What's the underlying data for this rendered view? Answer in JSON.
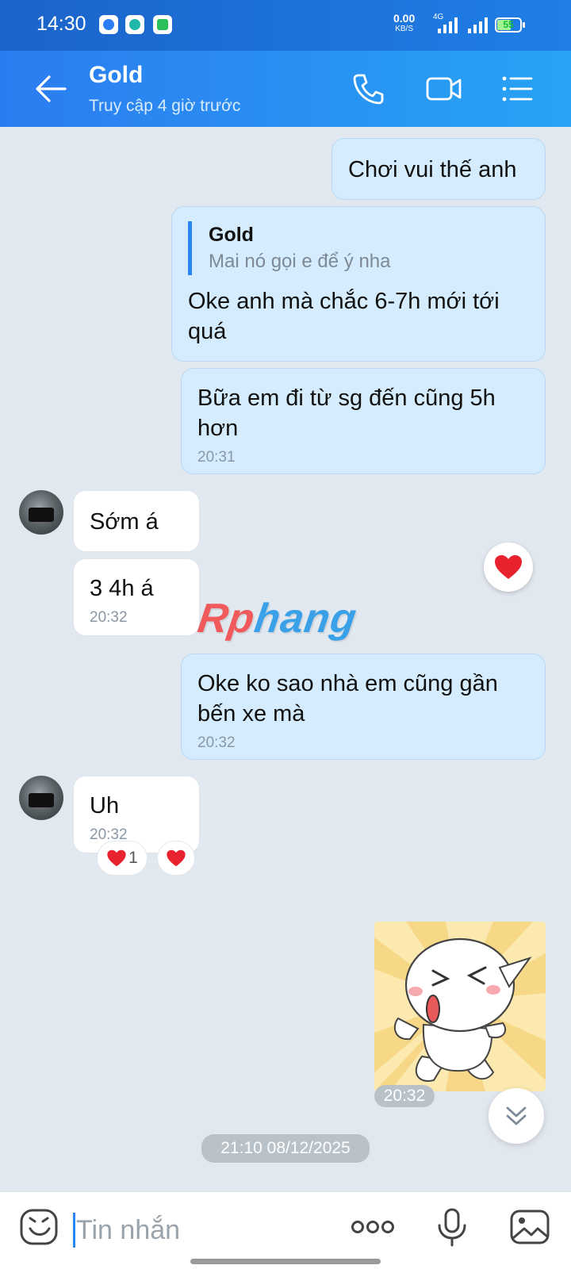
{
  "status_bar": {
    "time": "14:30",
    "net_speed": "0.00",
    "net_unit": "KB/S",
    "network": "4G",
    "battery": "55"
  },
  "header": {
    "name": "Gold",
    "status": "Truy cập 4 giờ trước",
    "icons": [
      "back-arrow-icon",
      "phone-icon",
      "video-call-icon",
      "menu-icon"
    ]
  },
  "messages": [
    {
      "side": "out",
      "text": "Chơi vui thế anh"
    },
    {
      "side": "out",
      "reply_to": {
        "name": "Gold",
        "text": "Mai nó gọi e để ý nha"
      },
      "text": "Oke anh mà chắc 6-7h mới tới quá"
    },
    {
      "side": "out",
      "text": "Bữa em đi từ sg đến cũng 5h hơn",
      "time": "20:31"
    },
    {
      "side": "in",
      "text": "Sớm á"
    },
    {
      "side": "in",
      "text": "3 4h á",
      "time": "20:32"
    },
    {
      "side": "out",
      "text": "Oke ko sao nhà em cũng gần bến xe mà",
      "time": "20:32"
    },
    {
      "side": "in",
      "text": "Uh",
      "time": "20:32",
      "reaction_count": "1"
    },
    {
      "side": "out",
      "type": "sticker",
      "time": "20:32"
    }
  ],
  "watermark": {
    "part1": "Rp",
    "part2": "hang"
  },
  "date_separator": "21:10 08/12/2025",
  "input": {
    "placeholder": "Tin nhắn"
  },
  "colors": {
    "header": "#2b7cf0",
    "outgoing_bubble": "#d4ecfd",
    "incoming_bubble": "#ffffff",
    "background": "#e2e8ef",
    "heart": "#e8232f"
  }
}
